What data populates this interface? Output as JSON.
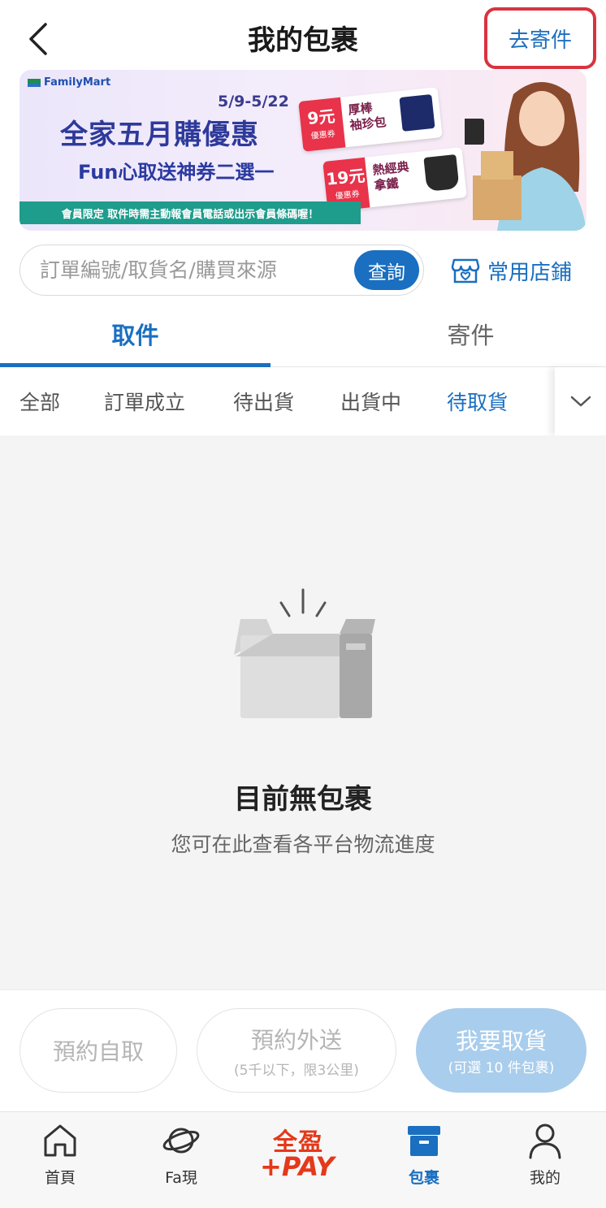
{
  "header": {
    "title": "我的包裹",
    "send_button": "去寄件"
  },
  "banner": {
    "brand": "FamilyMart",
    "date": "5/9-5/22",
    "title": "全家五月購優惠",
    "subtitle": "Fun心取送神券二選一",
    "bar_text": "會員限定 取件時需主動報會員電話或出示會員條碼喔！",
    "coupons": [
      {
        "amount": "9元",
        "label": "優惠券",
        "name": "厚棒\n袖珍包"
      },
      {
        "amount": "19元",
        "label": "優惠券",
        "name": "熱經典\n拿鐵"
      }
    ]
  },
  "search": {
    "placeholder": "訂單編號/取貨名/購買來源",
    "button": "查詢"
  },
  "favorite_store": "常用店鋪",
  "tabs": [
    {
      "label": "取件",
      "active": true
    },
    {
      "label": "寄件",
      "active": false
    }
  ],
  "filters": [
    {
      "label": "全部"
    },
    {
      "label": "訂單成立"
    },
    {
      "label": "待出貨"
    },
    {
      "label": "出貨中"
    },
    {
      "label": "待取貨",
      "active": true
    }
  ],
  "empty": {
    "title": "目前無包裹",
    "subtitle": "您可在此查看各平台物流進度"
  },
  "actions": {
    "self_pickup": "預約自取",
    "delivery": "預約外送",
    "delivery_note": "(5千以下，限3公里)",
    "pickup": "我要取貨",
    "pickup_note": "(可選 10 件包裹)"
  },
  "nav": {
    "home": "首頁",
    "fa": "Fa現",
    "pay_top": "全盈",
    "pay_bottom": "+PAY",
    "parcel": "包裹",
    "mine": "我的"
  },
  "colors": {
    "accent": "#1a6fc0",
    "highlight_border": "#d9333f",
    "pay_red": "#e4391b"
  }
}
